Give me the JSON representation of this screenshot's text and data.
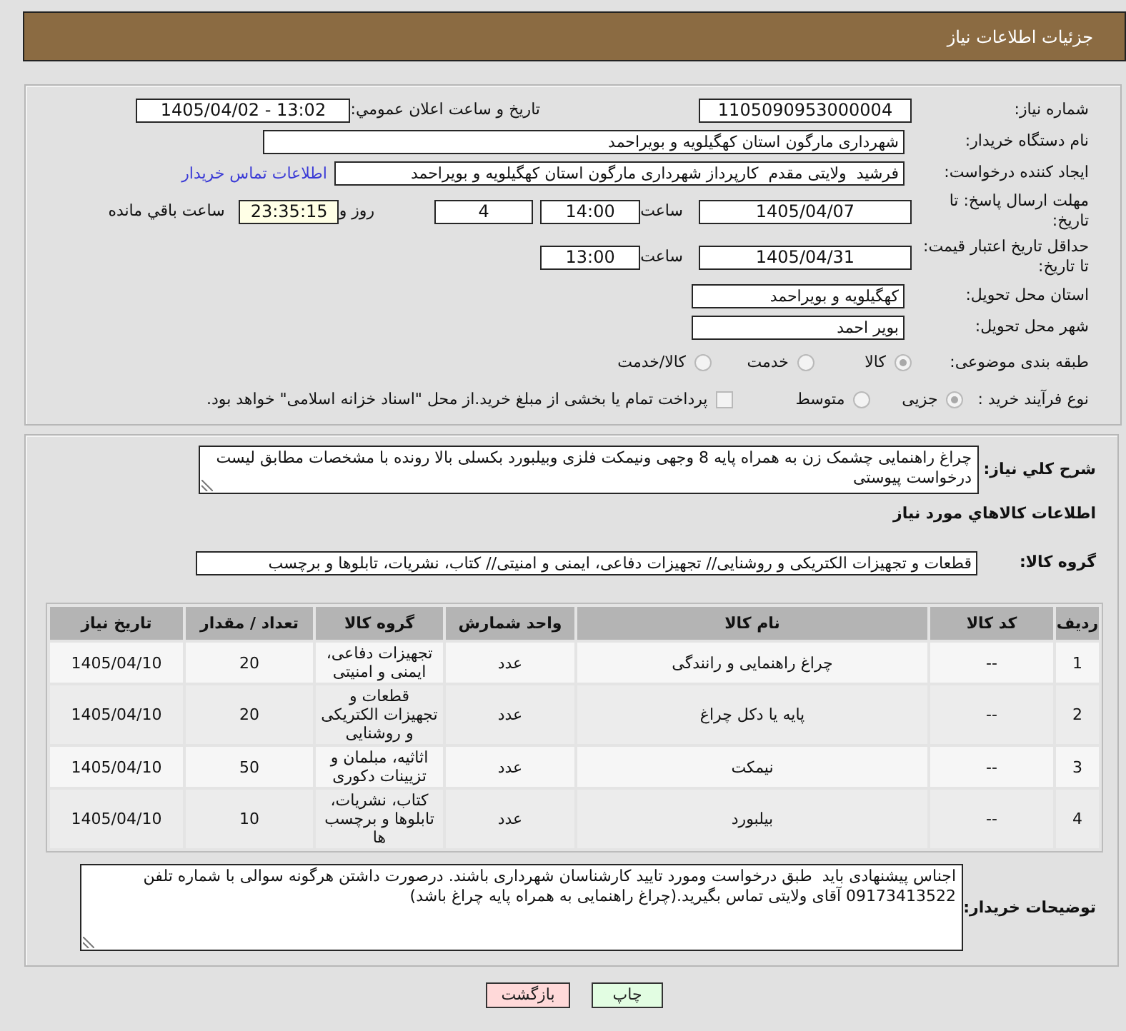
{
  "header": {
    "title": "جزئیات اطلاعات نیاز"
  },
  "details": {
    "need_number": {
      "label": "شماره نیاز:",
      "value": "1105090953000004"
    },
    "announcement": {
      "label": "تاریخ و ساعت اعلان عمومي:",
      "value": "1405/04/02 - 13:02"
    },
    "buyer_org": {
      "label": "نام دستگاه خریدار:",
      "value": "شهرداری مارگون استان کهگیلویه و بویراحمد"
    },
    "requester": {
      "label": "ایجاد کننده درخواست:",
      "value": "فرشید  ولایتی مقدم  کارپرداز شهرداری مارگون استان کهگیلویه و بویراحمد",
      "contact_link": "اطلاعات تماس خریدار"
    },
    "response_deadline": {
      "label": "مهلت ارسال پاسخ: تا تاریخ:",
      "date": "1405/04/07",
      "time_label": "ساعت",
      "time": "14:00",
      "days": "4",
      "days_label": "روز و",
      "remaining": "23:35:15",
      "remaining_label": "ساعت باقي مانده"
    },
    "price_validity": {
      "label": "حداقل تاریخ اعتبار قیمت: تا تاریخ:",
      "date": "1405/04/31",
      "time_label": "ساعت",
      "time": "13:00"
    },
    "delivery_province": {
      "label": "استان محل تحویل:",
      "value": "کهگیلویه و بویراحمد"
    },
    "delivery_city": {
      "label": "شهر محل تحویل:",
      "value": "بویر احمد"
    },
    "category": {
      "label": "طبقه بندی موضوعی:",
      "options": [
        {
          "label": "کالا",
          "selected": true
        },
        {
          "label": "خدمت",
          "selected": false
        },
        {
          "label": "کالا/خدمت",
          "selected": false
        }
      ]
    },
    "purchase_process": {
      "label": "نوع فرآیند خرید :",
      "options": [
        {
          "label": "جزیی",
          "selected": true
        },
        {
          "label": "متوسط",
          "selected": false
        }
      ],
      "treasury_payment": {
        "label": "پرداخت تمام یا بخشی از مبلغ خرید.از محل \"اسناد خزانه اسلامی\" خواهد بود.",
        "checked": false
      }
    }
  },
  "summary": {
    "label": "شرح کلي نیاز:",
    "value": "چراغ راهنمایی چشمک زن به همراه پایه 8 وجهی ونیمکت فلزی وبیلبورد بکسلی بالا رونده با مشخصات مطابق لیست درخواست پیوستی"
  },
  "goods": {
    "title": "اطلاعات کالاهاي مورد نیاز",
    "group_label": "گروه کالا:",
    "group_value": "قطعات و تجهیزات الکتریکی و روشنایی// تجهیزات دفاعی، ایمنی و امنیتی// کتاب، نشریات، تابلوها و برچسب",
    "table": {
      "columns": [
        "ردیف",
        "کد کالا",
        "نام کالا",
        "واحد شمارش",
        "گروه کالا",
        "تعداد / مقدار",
        "تاریخ نیاز"
      ],
      "rows": [
        [
          "1",
          "--",
          "چراغ راهنمایی و رانندگی",
          "عدد",
          "تجهیزات دفاعی، ایمنی و امنیتی",
          "20",
          "1405/04/10"
        ],
        [
          "2",
          "--",
          "پایه یا دکل چراغ",
          "عدد",
          "قطعات و تجهیزات الکتریکی و روشنایی",
          "20",
          "1405/04/10"
        ],
        [
          "3",
          "--",
          "نیمکت",
          "عدد",
          "اثاثیه، مبلمان و تزیینات دکوری",
          "50",
          "1405/04/10"
        ],
        [
          "4",
          "--",
          "بیلبورد",
          "عدد",
          "کتاب، نشریات، تابلوها و برچسب ها",
          "10",
          "1405/04/10"
        ]
      ]
    }
  },
  "notes": {
    "label": "توضیحات خریدار:",
    "value": "اجناس پیشنهادی باید  طبق درخواست ومورد تایید کارشناسان شهرداری باشند. درصورت داشتن هرگونه سوالی با شماره تلفن 09173413522 آقای ولایتی تماس بگیرید.(چراغ راهنمایی به همراه پایه چراغ باشد)"
  },
  "buttons": [
    {
      "label": "چاپ",
      "kind": "print"
    },
    {
      "label": "بازگشت",
      "kind": "back"
    }
  ]
}
